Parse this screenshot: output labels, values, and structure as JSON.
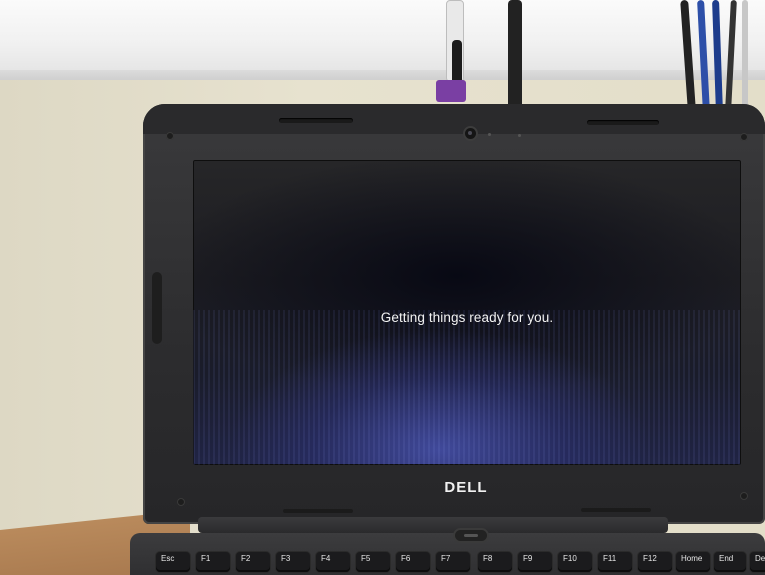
{
  "screen": {
    "status_message": "Getting things ready for you."
  },
  "laptop": {
    "brand": "DELL"
  },
  "keyboard": {
    "function_keys": [
      "Esc",
      "F1",
      "F2",
      "F3",
      "F4",
      "F5",
      "F6",
      "F7",
      "F8",
      "F9",
      "F10",
      "F11",
      "F12",
      "Home",
      "End",
      "Del"
    ]
  },
  "colors": {
    "screen_glow": "#4650aa",
    "cable_tag": "#7a3fa3",
    "fn_key_accent": "#2f7fe0"
  }
}
